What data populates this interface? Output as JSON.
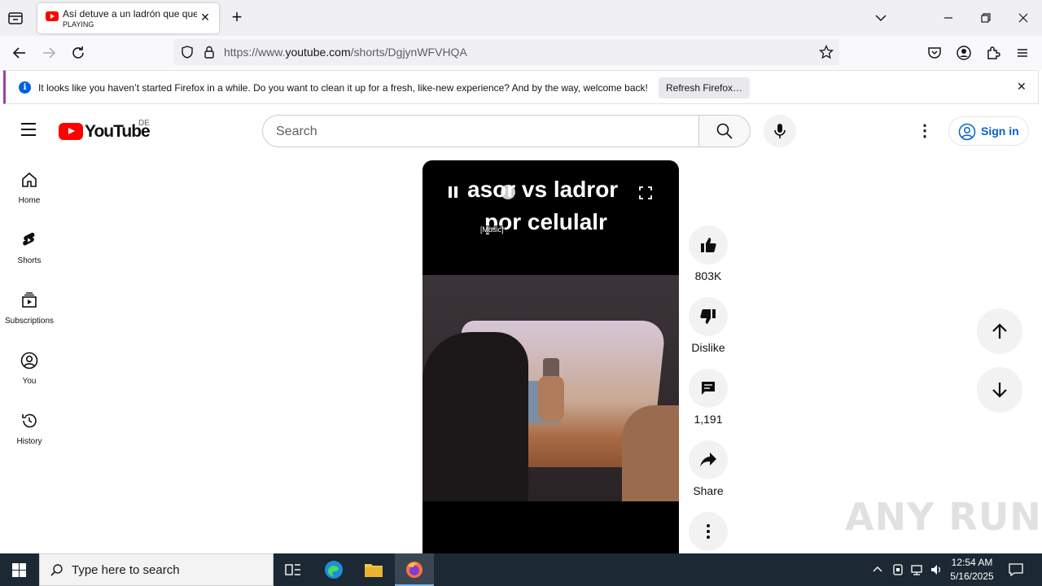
{
  "browser": {
    "tab": {
      "title": "Así detuve a un ladrón que quería robarme",
      "status": "PLAYING",
      "favicon": "youtube-favicon-icon"
    },
    "url": {
      "prefix": "https://www.",
      "domain": "youtube.com",
      "path": "/shorts/DgjynWFVHQA"
    },
    "notification": {
      "message": "It looks like you haven’t started Firefox in a while. Do you want to clean it up for a fresh, like-new experience? And by the way, welcome back!",
      "button": "Refresh Firefox…"
    }
  },
  "youtube": {
    "logo_text": "YouTube",
    "region": "DE",
    "search_placeholder": "Search",
    "signin": "Sign in",
    "sidebar": [
      {
        "label": "Home",
        "icon": "home-icon"
      },
      {
        "label": "Shorts",
        "icon": "shorts-icon"
      },
      {
        "label": "Subscriptions",
        "icon": "subscriptions-icon"
      },
      {
        "label": "You",
        "icon": "you-icon"
      },
      {
        "label": "History",
        "icon": "history-icon"
      }
    ],
    "player": {
      "caption_line1": "asor vs ladror",
      "caption_line2": "por celulalr",
      "cc": "[Music]"
    },
    "actions": {
      "likes": "803K",
      "dislike": "Dislike",
      "comments": "1,191",
      "share": "Share"
    }
  },
  "watermark": "ANY RUN",
  "taskbar": {
    "search_placeholder": "Type here to search",
    "time": "12:54 AM",
    "date": "5/16/2025"
  },
  "colors": {
    "brand_red": "#ff0000",
    "link_blue": "#065fd4",
    "taskbar": "#1c2833"
  }
}
